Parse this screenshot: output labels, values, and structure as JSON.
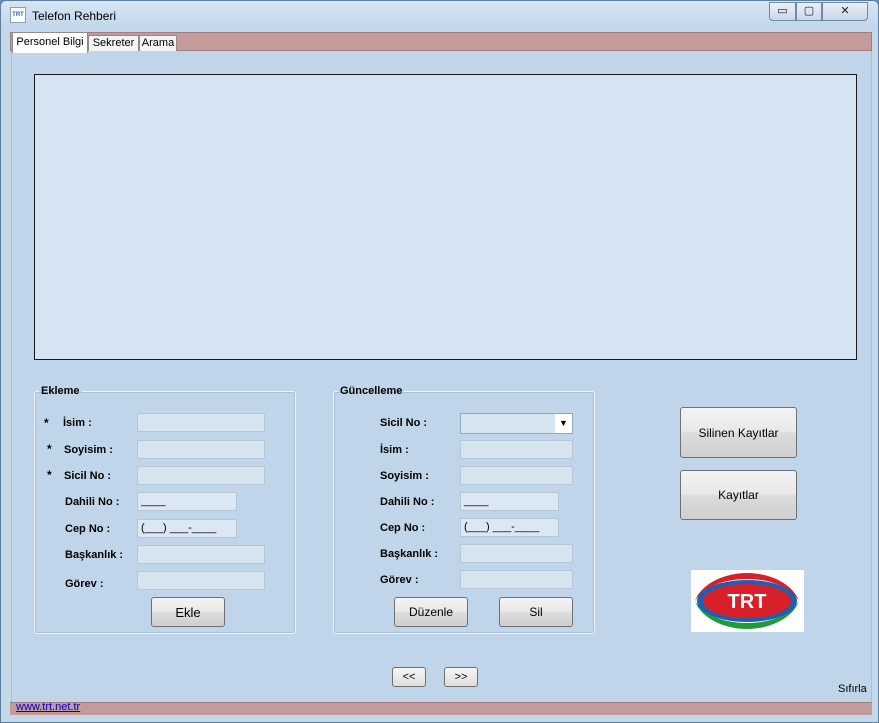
{
  "window": {
    "title": "Telefon Rehberi",
    "icon_text": "TRT",
    "controls": {
      "minimize": "▭",
      "maximize": "▢",
      "close": "✕"
    }
  },
  "tabs": [
    {
      "label": "Personel Bilgi",
      "active": true
    },
    {
      "label": "Sekreter",
      "active": false
    },
    {
      "label": "Arama",
      "active": false
    }
  ],
  "ekleme": {
    "legend": "Ekleme",
    "required_mark": "*",
    "fields": {
      "isim": {
        "label": "İsim :",
        "value": ""
      },
      "soyisim": {
        "label": "Soyisim :",
        "value": ""
      },
      "sicil_no": {
        "label": "Sicil No :",
        "value": ""
      },
      "dahili_no": {
        "label": "Dahili No :",
        "value": "____"
      },
      "cep_no": {
        "label": "Cep No :",
        "value": "(___) ___-____"
      },
      "baskanlik": {
        "label": "Başkanlık :",
        "value": ""
      },
      "gorev": {
        "label": "Görev :",
        "value": ""
      }
    },
    "add_button": "Ekle"
  },
  "guncelleme": {
    "legend": "Güncelleme",
    "fields": {
      "sicil_no": {
        "label": "Sicil No :",
        "value": ""
      },
      "isim": {
        "label": "İsim :",
        "value": ""
      },
      "soyisim": {
        "label": "Soyisim :",
        "value": ""
      },
      "dahili_no": {
        "label": "Dahili No :",
        "value": "____"
      },
      "cep_no": {
        "label": "Cep No :",
        "value": "(___) ___-____"
      },
      "baskanlik": {
        "label": "Başkanlık :",
        "value": ""
      },
      "gorev": {
        "label": "Görev :",
        "value": ""
      }
    },
    "edit_button": "Düzenle",
    "delete_button": "Sil"
  },
  "side_buttons": {
    "deleted_records": "Silinen Kayıtlar",
    "records": "Kayıtlar"
  },
  "logo": {
    "text": "TRT",
    "colors": {
      "red": "#d8202a",
      "green": "#1f9a3c",
      "blue": "#1f5fb0"
    }
  },
  "navigation": {
    "prev": "<<",
    "next": ">>"
  },
  "reset_label": "Sıfırla",
  "footer_link": "www.trt.net.tr",
  "colors": {
    "tab_strip": "#c39b9b",
    "panel": "#c0d5ea",
    "grid": "#d4e4f2",
    "link": "#0000cc"
  }
}
